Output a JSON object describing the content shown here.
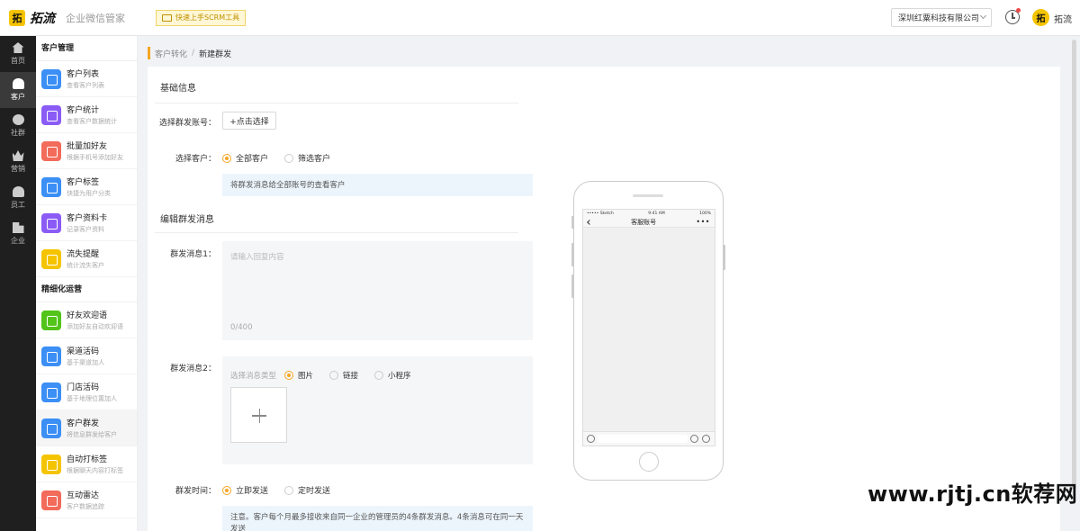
{
  "header": {
    "logo_mark": "拓",
    "logo_text": "拓流",
    "logo_sub": "企业微信管家",
    "quick_start": "快速上手SCRM工具",
    "company": "深圳红粟科技有限公司",
    "user_avatar": "拓",
    "user_name": "拓流"
  },
  "rail": {
    "items": [
      {
        "label": "首页",
        "icon": "home-icon"
      },
      {
        "label": "客户",
        "icon": "customer-icon"
      },
      {
        "label": "社群",
        "icon": "chat-icon"
      },
      {
        "label": "营销",
        "icon": "crown-icon"
      },
      {
        "label": "员工",
        "icon": "staff-icon"
      },
      {
        "label": "企业",
        "icon": "building-icon"
      }
    ]
  },
  "subnav": {
    "group1_title": "客户管理",
    "group2_title": "精细化运营",
    "group1": [
      {
        "label": "客户列表",
        "desc": "查看客户列表",
        "color": "#3b8ff5"
      },
      {
        "label": "客户统计",
        "desc": "查看客户数据统计",
        "color": "#8a5cf5"
      },
      {
        "label": "批量加好友",
        "desc": "根据手机号添加好友",
        "color": "#f26b5b"
      },
      {
        "label": "客户标签",
        "desc": "快捷为用户分类",
        "color": "#3b8ff5"
      },
      {
        "label": "客户资料卡",
        "desc": "记录客户资料",
        "color": "#8a5cf5"
      },
      {
        "label": "流失提醒",
        "desc": "统计流失客户",
        "color": "#f5c400"
      }
    ],
    "group2": [
      {
        "label": "好友欢迎语",
        "desc": "添加好友自动欢迎语",
        "color": "#52c41a"
      },
      {
        "label": "渠道活码",
        "desc": "基于渠道加人",
        "color": "#3b8ff5"
      },
      {
        "label": "门店活码",
        "desc": "基于地理位置加人",
        "color": "#3b8ff5"
      },
      {
        "label": "客户群发",
        "desc": "将信息群发给客户",
        "color": "#3b8ff5"
      },
      {
        "label": "自动打标签",
        "desc": "根据聊天内容打标签",
        "color": "#f5c400"
      },
      {
        "label": "互动雷达",
        "desc": "客户数据追踪",
        "color": "#f26b5b"
      }
    ]
  },
  "breadcrumb": {
    "parent": "客户转化",
    "sep": "/",
    "current": "新建群发"
  },
  "form": {
    "basic_title": "基础信息",
    "account_label": "选择群发账号：",
    "account_button": "+点击选择",
    "customer_label": "选择客户：",
    "customer_opt_all": "全部客户",
    "customer_opt_filter": "筛选客户",
    "customer_info": "将群发消息给全部账号的查看客户",
    "edit_title": "编辑群发消息",
    "msg1_label": "群发消息1：",
    "msg1_placeholder": "请输入回复内容",
    "msg1_count": "0/400",
    "msg2_label": "群发消息2：",
    "msg2_type_label": "选择消息类型",
    "msg2_opt_image": "图片",
    "msg2_opt_link": "链接",
    "msg2_opt_mini": "小程序",
    "time_label": "群发时间：",
    "time_opt_now": "立即发送",
    "time_opt_scheduled": "定时发送",
    "time_notice": "注意。客户每个月最多接收来自同一企业的管理员的4条群发消息。4条消息可在同一天发送"
  },
  "phone": {
    "carrier": "••••• Sketch",
    "time": "9:41 AM",
    "battery": "100%",
    "chat_title": "客服账号",
    "more": "•••"
  },
  "watermark": "www.rjtj.cn软荐网"
}
